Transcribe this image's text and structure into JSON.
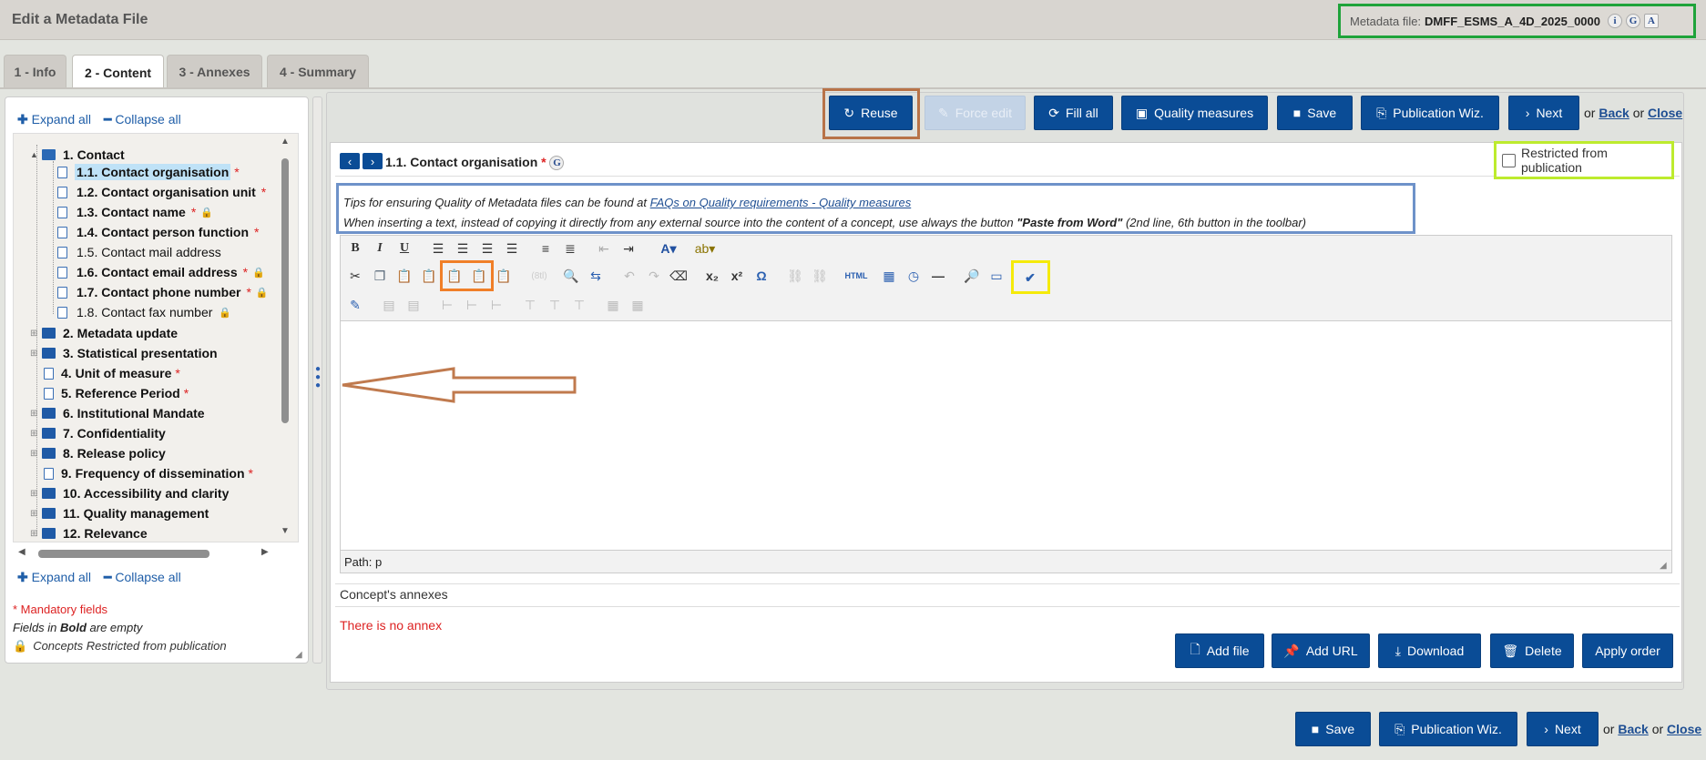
{
  "window": {
    "title": "Edit a Metadata File"
  },
  "metadata": {
    "label": "Metadata file:",
    "file_id": "DMFF_ESMS_A_4D_2025_0000",
    "icons": [
      "info-icon",
      "google-translate-icon",
      "accessibility-icon"
    ]
  },
  "tabs": [
    {
      "label": "1 - Info"
    },
    {
      "label": "2 - Content"
    },
    {
      "label": "3 - Annexes"
    },
    {
      "label": "4 - Summary"
    }
  ],
  "tree_controls": {
    "expand": "Expand all",
    "collapse": "Collapse all"
  },
  "tree": {
    "contact": "1. Contact",
    "items": [
      {
        "label": "1.1. Contact organisation",
        "mandatory": true,
        "bold": true,
        "selected": true
      },
      {
        "label": "1.2. Contact organisation unit",
        "mandatory": true,
        "bold": true
      },
      {
        "label": "1.3. Contact name",
        "mandatory": true,
        "bold": true,
        "locked": true
      },
      {
        "label": "1.4. Contact person function",
        "mandatory": true,
        "bold": true
      },
      {
        "label": "1.5. Contact mail address",
        "mandatory": false,
        "bold": false
      },
      {
        "label": "1.6. Contact email address",
        "mandatory": true,
        "bold": true,
        "locked": true
      },
      {
        "label": "1.7. Contact phone number",
        "mandatory": true,
        "bold": true,
        "locked": true
      },
      {
        "label": "1.8. Contact fax number",
        "mandatory": false,
        "bold": false,
        "locked": true
      }
    ],
    "sections": [
      {
        "label": "2. Metadata update",
        "type": "folder"
      },
      {
        "label": "3. Statistical presentation",
        "type": "folder"
      },
      {
        "label": "4. Unit of measure",
        "type": "doc",
        "mandatory": true
      },
      {
        "label": "5. Reference Period",
        "type": "doc",
        "mandatory": true
      },
      {
        "label": "6. Institutional Mandate",
        "type": "folder"
      },
      {
        "label": "7. Confidentiality",
        "type": "folder"
      },
      {
        "label": "8. Release policy",
        "type": "folder"
      },
      {
        "label": "9. Frequency of dissemination",
        "type": "doc",
        "mandatory": true
      },
      {
        "label": "10. Accessibility and clarity",
        "type": "folder"
      },
      {
        "label": "11. Quality management",
        "type": "folder"
      },
      {
        "label": "12. Relevance",
        "type": "folder"
      }
    ]
  },
  "legend": {
    "mandatory": "* Mandatory fields",
    "bold_prefix": "Fields in ",
    "bold_word": "Bold",
    "bold_suffix": " are empty",
    "restricted": "Concepts Restricted from publication"
  },
  "actions": {
    "reuse": "Reuse",
    "force_edit": "Force edit",
    "fill_all": "Fill all",
    "quality_measures": "Quality measures",
    "save": "Save",
    "publication_wiz": "Publication Wiz.",
    "next": "Next",
    "or1": "or",
    "back": "Back",
    "or2": "or",
    "close": "Close"
  },
  "concept": {
    "title": "1.1. Contact organisation",
    "mandatory_mark": "*"
  },
  "restricted": {
    "label": "Restricted from publication",
    "checked": false
  },
  "tips": {
    "line1_prefix": "Tips for ensuring Quality of Metadata files can be found at ",
    "line1_link": "FAQs on Quality requirements - Quality measures",
    "line2_prefix": "When inserting a text, instead of copying it directly from any external source into the content of a concept, use always the button ",
    "line2_bold": "\"Paste from Word\"",
    "line2_suffix": " (2nd line, 6th button in the toolbar)"
  },
  "editor": {
    "path_label": "Path: p"
  },
  "annexes": {
    "title": "Concept's annexes",
    "empty": "There is no annex",
    "add_file": "Add file",
    "add_url": "Add URL",
    "download": "Download",
    "delete": "Delete",
    "apply_order": "Apply order"
  },
  "footer": {
    "save": "Save",
    "publication_wiz": "Publication Wiz.",
    "next": "Next",
    "or1": "or",
    "back": "Back",
    "or2": "or",
    "close": "Close"
  },
  "highlight_colors": {
    "metadata": "#1fa33a",
    "reuse": "#b87348",
    "restricted": "#bdeb2e",
    "tips": "#6e92c9",
    "paste_buttons": "#f07f28",
    "spellcheck": "#f5ea0a",
    "arrow": "#c07a4e"
  }
}
